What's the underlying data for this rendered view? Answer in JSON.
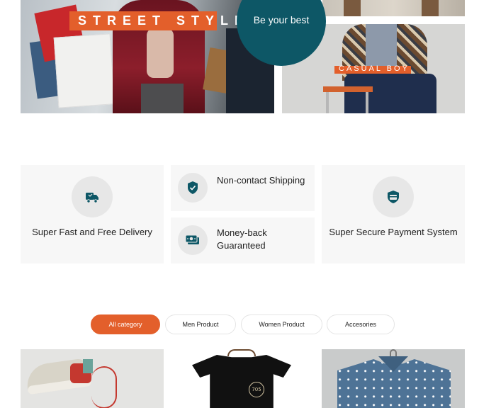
{
  "hero": {
    "banner_left_label": "STREET STYLE",
    "circle_text": "Be your best",
    "banner_right_label": "CASUAL BOY"
  },
  "features": [
    {
      "title": "Super Fast and Free Delivery",
      "icon": "delivery-truck-icon"
    },
    {
      "title": "Non-contact Shipping",
      "icon": "shield-check-icon"
    },
    {
      "title": "Money-back Guaranteed",
      "icon": "money-icon"
    },
    {
      "title": "Super Secure Payment System",
      "icon": "secure-card-icon"
    }
  ],
  "categories": {
    "tabs": [
      "All category",
      "Men Product",
      "Women Product",
      "Accesories"
    ],
    "active": "All category"
  },
  "products": [
    {
      "image": "sneaker"
    },
    {
      "image": "black-tshirt",
      "logo_text": "705"
    },
    {
      "image": "denim-shirt"
    }
  ],
  "colors": {
    "accent": "#e35f2b",
    "circle": "#0d5766",
    "icon": "#0d5766",
    "card_bg": "#f7f7f7"
  }
}
